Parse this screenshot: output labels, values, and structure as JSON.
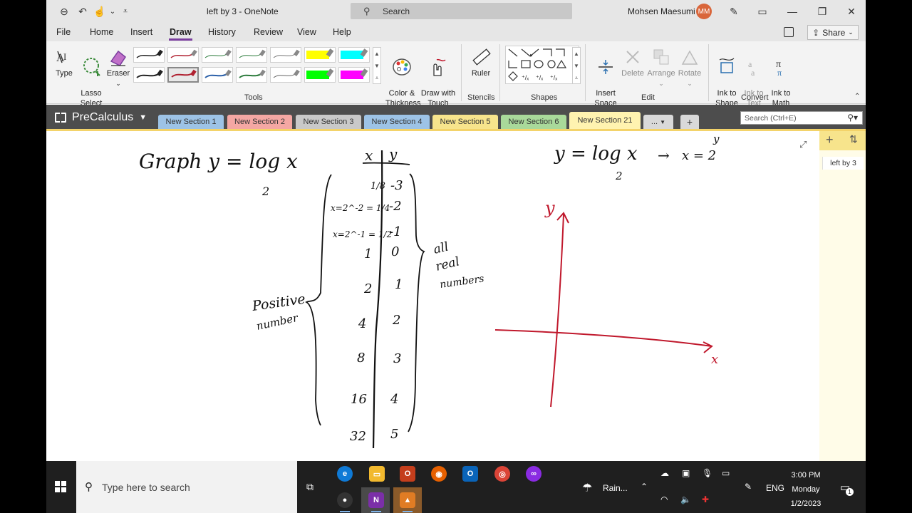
{
  "titlebar": {
    "doc_title": "left by 3  -  OneNote",
    "search_label": "Search",
    "user_name": "Mohsen Maesumi",
    "user_initials": "MM"
  },
  "menu_tabs": [
    "File",
    "Home",
    "Insert",
    "Draw",
    "History",
    "Review",
    "View",
    "Help"
  ],
  "active_tab": "Draw",
  "share_label": "Share",
  "ribbon": {
    "tools": {
      "type_label": "Type",
      "lasso_label": "Lasso\nSelect",
      "eraser_label": "Eraser",
      "color_label": "Color &\nThickness",
      "touch_label": "Draw with\nTouch",
      "group": "Tools"
    },
    "stencils": {
      "ruler_label": "Ruler",
      "group": "Stencils"
    },
    "shapes": {
      "group": "Shapes"
    },
    "edit": {
      "insert_space": "Insert\nSpace",
      "delete": "Delete",
      "arrange": "Arrange",
      "rotate": "Rotate",
      "group": "Edit"
    },
    "convert": {
      "ink_to_shape": "Ink to\nShape",
      "ink_to_text": "Ink to\nText",
      "ink_to_math": "Ink to\nMath",
      "group": "Convert"
    },
    "pen_colors_row1": [
      "#222222",
      "#b02030",
      "#2a7a3a",
      "#2a7a3a",
      "#555555",
      "#ffff00",
      "#00ffff"
    ],
    "pen_colors_row2": [
      "#222222",
      "#b02030",
      "#2a5fa8",
      "#2a7a3a",
      "#555555",
      "#00ff00",
      "#ff00ff"
    ]
  },
  "notebook": {
    "name": "PreCalculus",
    "sections": [
      {
        "label": "New Section 1",
        "color": "#9dc3e6"
      },
      {
        "label": "New Section 2",
        "color": "#f4a7a3"
      },
      {
        "label": "New Section 3",
        "color": "#c9c9c9"
      },
      {
        "label": "New Section 4",
        "color": "#9dc3e6"
      },
      {
        "label": "New Section 5",
        "color": "#f7e48c"
      },
      {
        "label": "New Section 6",
        "color": "#a9d99a"
      },
      {
        "label": "New Section 21",
        "color": "#fff3b0"
      }
    ],
    "more_label": "...",
    "search_placeholder": "Search (Ctrl+E)",
    "page_title": "left by 3"
  },
  "page_content": {
    "left_title": "Graph  y = log x",
    "left_base": "2",
    "table_header_x": "x",
    "table_header_y": "y",
    "table_rows": [
      {
        "x": "1/8",
        "y": "-3"
      },
      {
        "x": "x=2^-2 = 1/4",
        "y": "-2"
      },
      {
        "x": "x=2^-1 = 1/2",
        "y": "-1"
      },
      {
        "x": "1",
        "y": "0"
      },
      {
        "x": "2",
        "y": "1"
      },
      {
        "x": "4",
        "y": "2"
      },
      {
        "x": "8",
        "y": "3"
      },
      {
        "x": "16",
        "y": "4"
      },
      {
        "x": "32",
        "y": "5"
      }
    ],
    "domain_note_1": "Positive",
    "domain_note_2": "number",
    "range_note_1": "all",
    "range_note_2": "real",
    "range_note_3": "numbers",
    "right_eq": "y = log x",
    "right_base": "2",
    "arrow": "→",
    "right_exp": "x = 2",
    "right_exp_power": "y",
    "axis_y_label": "y",
    "axis_x_label": "x",
    "ink_color": "#c0182c",
    "ink_black": "#111111"
  },
  "taskbar": {
    "search_placeholder": "Type here to search",
    "weather": "Rain...",
    "language": "ENG",
    "time": "3:00 PM",
    "day": "Monday",
    "date": "1/2/2023",
    "notification_count": "1"
  }
}
